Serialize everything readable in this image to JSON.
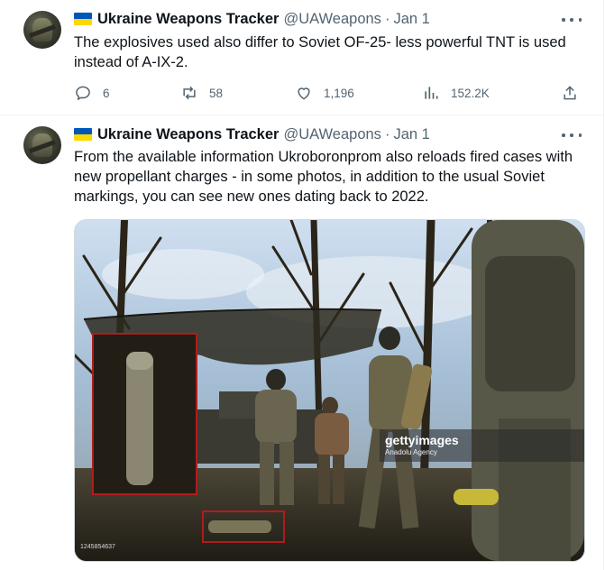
{
  "tweets": [
    {
      "display_name": "Ukraine Weapons Tracker",
      "handle": "@UAWeapons",
      "separator": "·",
      "date": "Jan 1",
      "text": "The explosives used also differ to Soviet OF-25- less powerful TNT is used instead of A-IX-2.",
      "replies": "6",
      "retweets": "58",
      "likes": "1,196",
      "views": "152.2K"
    },
    {
      "display_name": "Ukraine Weapons Tracker",
      "handle": "@UAWeapons",
      "separator": "·",
      "date": "Jan 1",
      "text": "From the available information Ukroboronprom also reloads fired cases with new propellant charges - in some photos, in addition to the usual Soviet markings, you can see new ones dating back to 2022.",
      "image": {
        "watermark_brand": "gettyimages",
        "watermark_credit": "Anadolu Agency",
        "image_id": "1245854637"
      }
    }
  ],
  "icons": {
    "flag": "ukraine-flag-icon",
    "more": "more-icon",
    "reply": "reply-icon",
    "retweet": "retweet-icon",
    "like": "like-icon",
    "views": "views-icon",
    "share": "share-icon"
  },
  "colors": {
    "text": "#0f1419",
    "secondary": "#536471",
    "flag_blue": "#0057b7",
    "flag_yellow": "#ffd700",
    "annotation_red": "#b01c1c"
  }
}
